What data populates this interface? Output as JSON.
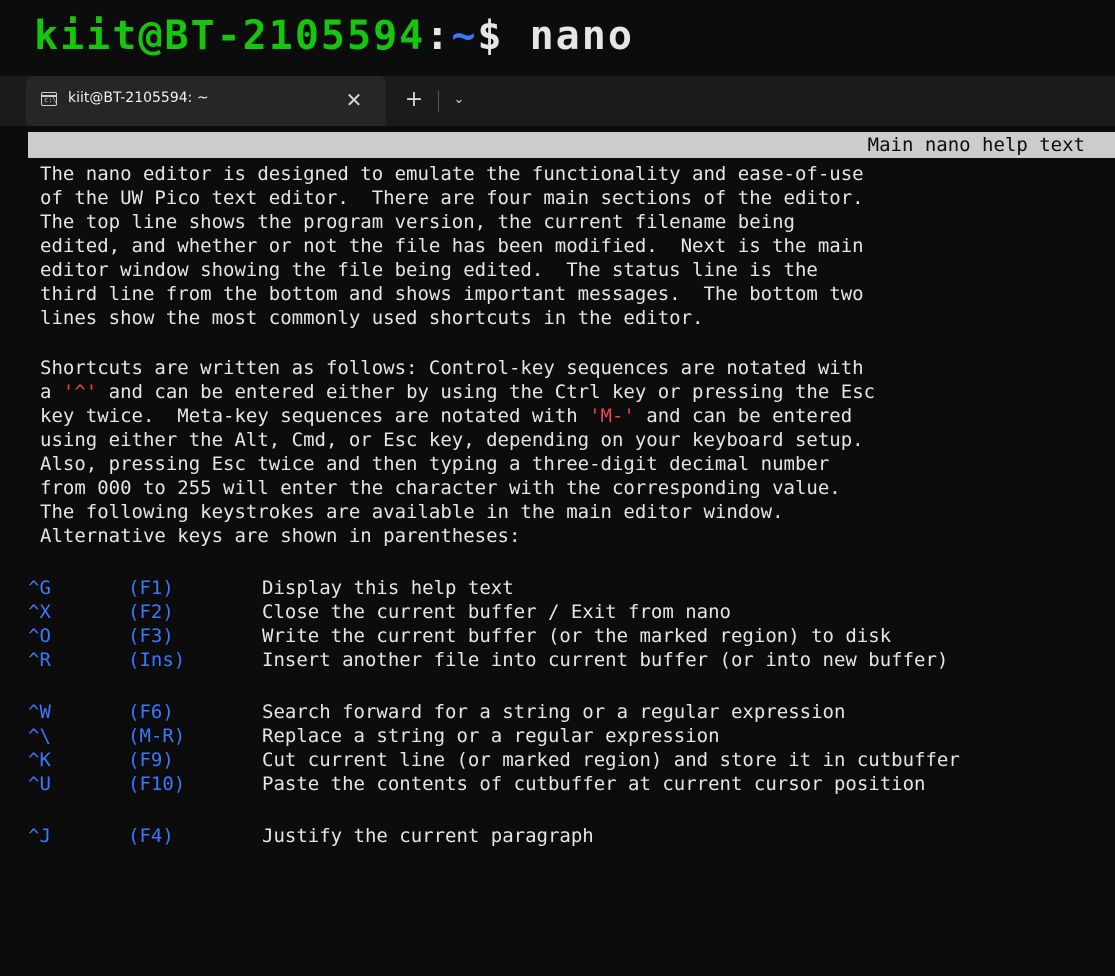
{
  "banner": {
    "user_host": "kiit@BT-2105594",
    "colon": ":",
    "path": "~",
    "prompt": "$ ",
    "command": "nano"
  },
  "tab": {
    "icon": "terminal-icon",
    "title": "kiit@BT-2105594: ~",
    "close_glyph": "✕",
    "new_tab_glyph": "+",
    "dropdown_glyph": "⌄"
  },
  "nano": {
    "header": "Main nano help text",
    "intro": [
      "The nano editor is designed to emulate the functionality and ease-of-use",
      "of the UW Pico text editor.  There are four main sections of the editor.",
      "The top line shows the program version, the current filename being",
      "edited, and whether or not the file has been modified.  Next is the main",
      "editor window showing the file being edited.  The status line is the",
      "third line from the bottom and shows important messages.  The bottom two",
      "lines show the most commonly used shortcuts in the editor."
    ],
    "shortcuts_para": {
      "l1": "Shortcuts are written as follows: Control-key sequences are notated with",
      "l2_pre": "a ",
      "l2_hl": "'^'",
      "l2_post": " and can be entered either by using the Ctrl key or pressing the Esc",
      "l3_pre": "key twice.  Meta-key sequences are notated with ",
      "l3_hl": "'M-'",
      "l3_post": " and can be entered",
      "l4": "using either the Alt, Cmd, or Esc key, depending on your keyboard setup.",
      "l5": "Also, pressing Esc twice and then typing a three-digit decimal number",
      "l6": "from 000 to 255 will enter the character with the corresponding value.",
      "l7": "The following keystrokes are available in the main editor window.",
      "l8": "Alternative keys are shown in parentheses:"
    },
    "keys": [
      {
        "key": "^G",
        "alt": "(F1)",
        "desc": "Display this help text"
      },
      {
        "key": "^X",
        "alt": "(F2)",
        "desc": "Close the current buffer / Exit from nano"
      },
      {
        "key": "^O",
        "alt": "(F3)",
        "desc": "Write the current buffer (or the marked region) to disk"
      },
      {
        "key": "^R",
        "alt": "(Ins)",
        "desc": "Insert another file into current buffer (or into new buffer)"
      },
      {
        "key": "^W",
        "alt": "(F6)",
        "desc": "Search forward for a string or a regular expression"
      },
      {
        "key": "^\\",
        "alt": "(M-R)",
        "desc": "Replace a string or a regular expression"
      },
      {
        "key": "^K",
        "alt": "(F9)",
        "desc": "Cut current line (or marked region) and store it in cutbuffer"
      },
      {
        "key": "^U",
        "alt": "(F10)",
        "desc": "Paste the contents of cutbuffer at current cursor position"
      },
      {
        "key": "^J",
        "alt": "(F4)",
        "desc": "Justify the current paragraph"
      }
    ]
  }
}
